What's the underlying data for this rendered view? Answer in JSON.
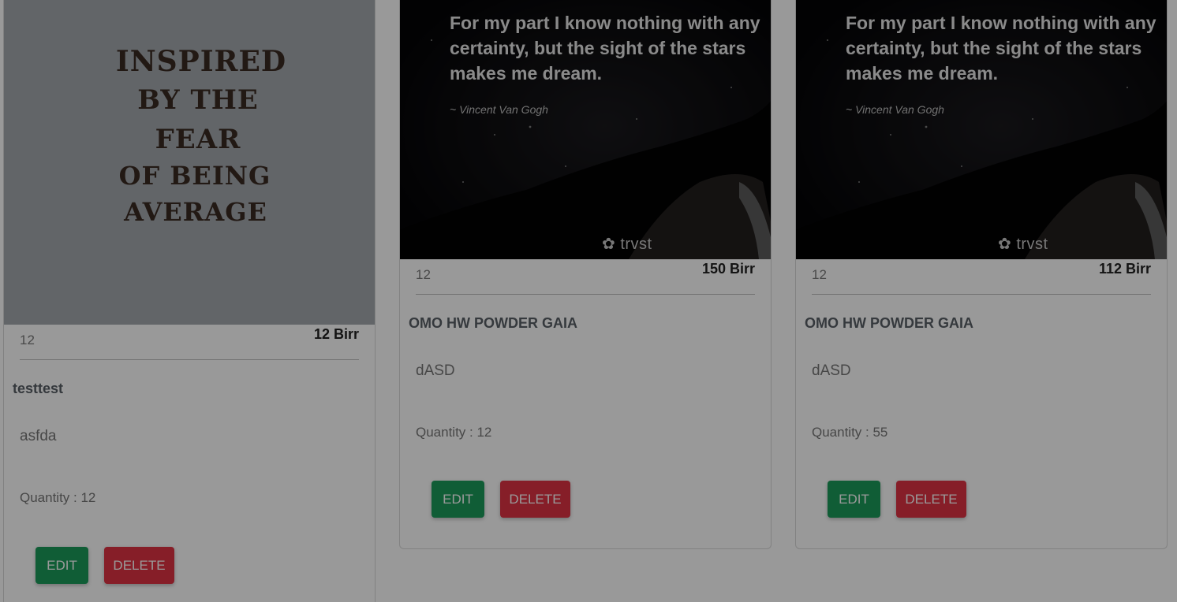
{
  "cards": [
    {
      "image_text": [
        "INSPIRED",
        "BY THE",
        "FEAR",
        "OF BEING",
        "AVERAGE"
      ],
      "sku": "12",
      "price": "12 Birr",
      "name": "testtest",
      "description": "asfda",
      "quantity": "Quantity : 12",
      "edit_label": "EDIT",
      "delete_label": "DELETE"
    },
    {
      "image_quote": "For my part I know nothing with any certainty, but the sight of the stars makes me dream.",
      "image_author": "~ Vincent Van Gogh",
      "image_brand": "trvst",
      "sku": "12",
      "price": "150 Birr",
      "name": "OMO HW POWDER GAIA",
      "description": "dASD",
      "quantity": "Quantity : 12",
      "edit_label": "EDIT",
      "delete_label": "DELETE"
    },
    {
      "image_quote": "For my part I know nothing with any certainty, but the sight of the stars makes me dream.",
      "image_author": "~ Vincent Van Gogh",
      "image_brand": "trvst",
      "sku": "12",
      "price": "112 Birr",
      "name": "OMO HW POWDER GAIA",
      "description": "dASD",
      "quantity": "Quantity : 55",
      "edit_label": "EDIT",
      "delete_label": "DELETE"
    }
  ],
  "colors": {
    "edit_button": "#1b9c5a",
    "delete_button": "#e03344",
    "overlay": "rgba(0,0,0,0.4)"
  }
}
